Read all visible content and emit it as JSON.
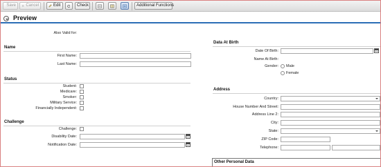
{
  "toolbar": {
    "save_label": "Save",
    "cancel_label": "Cancel",
    "edit_label": "Edit",
    "check_label": "Check",
    "additional_functions_label": "Additional Functions"
  },
  "preview": {
    "title": "Preview"
  },
  "top": {
    "also_valid_for": "Also Valid for:"
  },
  "name": {
    "title": "Name",
    "first_name": "First Name:",
    "last_name": "Last Name:"
  },
  "status": {
    "title": "Status",
    "student": "Student:",
    "medicare": "Medicare:",
    "smoker": "Smoker:",
    "military_service": "Military Service:",
    "financially_independent": "Financially Independent:"
  },
  "challenge": {
    "title": "Challenge",
    "challenge": "Challenge:",
    "disability_date": "Disability Date:",
    "notification_date": "Notification Date:"
  },
  "birth": {
    "title": "Data At Birth",
    "date_of_birth": "Date Of Birth:",
    "name_at_birth": "Name At Birth:",
    "gender": "Gender:",
    "male": "Male",
    "female": "Female"
  },
  "address": {
    "title": "Address",
    "country": "Country:",
    "house_number_street": "House Number And Street:",
    "address_line_2": "Address Line 2:",
    "city": "City:",
    "state": "State:",
    "zip_code": "ZIP Code:",
    "telephone": "Telephone:"
  },
  "other": {
    "title": "Other Personal Data"
  }
}
